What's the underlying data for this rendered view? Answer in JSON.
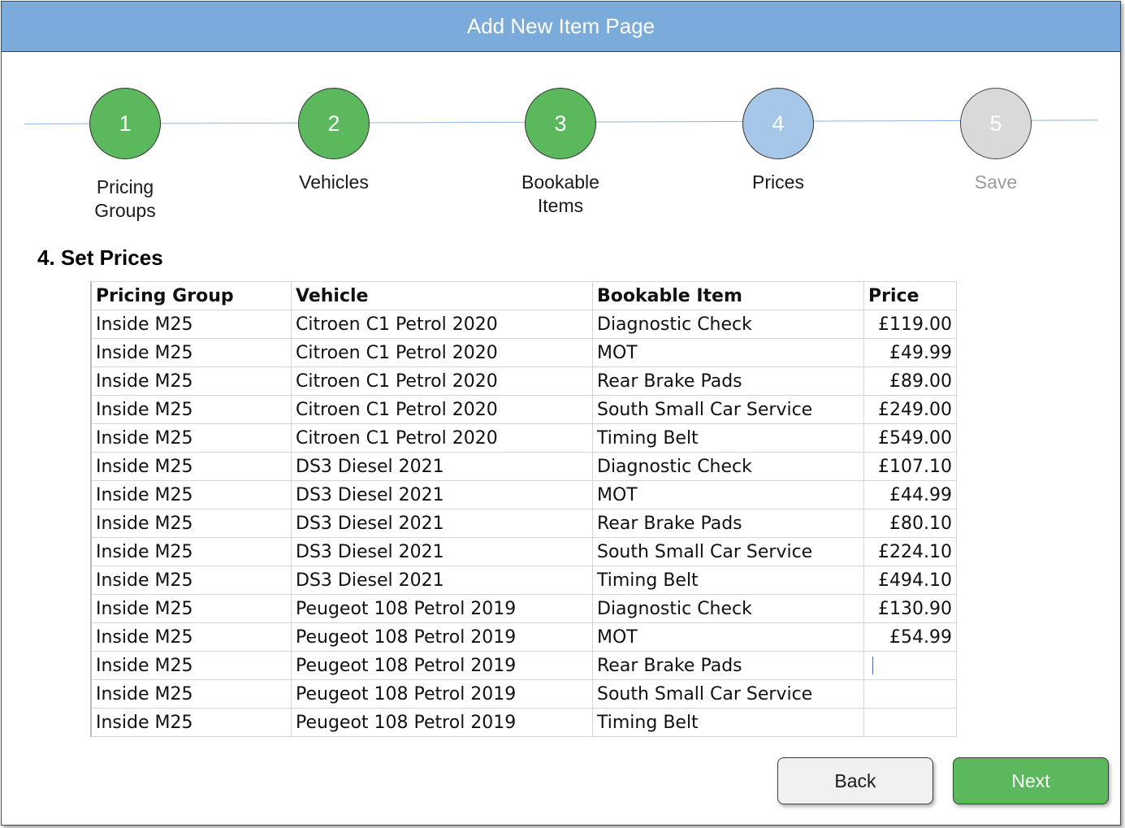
{
  "window": {
    "title": "Add New Item Page"
  },
  "steps": [
    {
      "number": "1",
      "label": "Pricing Groups",
      "state": "done"
    },
    {
      "number": "2",
      "label": "Vehicles",
      "state": "done"
    },
    {
      "number": "3",
      "label": "Bookable Items",
      "state": "done"
    },
    {
      "number": "4",
      "label": "Prices",
      "state": "active"
    },
    {
      "number": "5",
      "label": "Save",
      "state": "pending"
    }
  ],
  "section": {
    "title": "4. Set Prices"
  },
  "table": {
    "headers": [
      "Pricing Group",
      "Vehicle",
      "Bookable Item",
      "Price"
    ],
    "rows": [
      [
        "Inside M25",
        "Citroen C1 Petrol 2020",
        "Diagnostic Check",
        "£119.00"
      ],
      [
        "Inside M25",
        "Citroen C1 Petrol 2020",
        "MOT",
        "£49.99"
      ],
      [
        "Inside M25",
        "Citroen C1 Petrol 2020",
        "Rear Brake Pads",
        "£89.00"
      ],
      [
        "Inside M25",
        "Citroen C1 Petrol 2020",
        "South Small Car Service",
        "£249.00"
      ],
      [
        "Inside M25",
        "Citroen C1 Petrol 2020",
        "Timing Belt",
        "£549.00"
      ],
      [
        "Inside M25",
        "DS3 Diesel 2021",
        "Diagnostic Check",
        "£107.10"
      ],
      [
        "Inside M25",
        "DS3 Diesel 2021",
        "MOT",
        "£44.99"
      ],
      [
        "Inside M25",
        "DS3 Diesel 2021",
        "Rear Brake Pads",
        "£80.10"
      ],
      [
        "Inside M25",
        "DS3 Diesel 2021",
        "South Small Car Service",
        "£224.10"
      ],
      [
        "Inside M25",
        "DS3 Diesel 2021",
        "Timing Belt",
        "£494.10"
      ],
      [
        "Inside M25",
        "Peugeot 108 Petrol 2019",
        "Diagnostic Check",
        "£130.90"
      ],
      [
        "Inside M25",
        "Peugeot 108 Petrol 2019",
        "MOT",
        "£54.99"
      ],
      [
        "Inside M25",
        "Peugeot 108 Petrol 2019",
        "Rear Brake Pads",
        ""
      ],
      [
        "Inside M25",
        "Peugeot 108 Petrol 2019",
        "South Small Car Service",
        ""
      ],
      [
        "Inside M25",
        "Peugeot 108 Petrol 2019",
        "Timing Belt",
        ""
      ]
    ]
  },
  "buttons": {
    "back_label": "Back",
    "next_label": "Next"
  },
  "colors": {
    "header": "#7aabdb",
    "done": "#5cb85c",
    "active": "#a7c7e8",
    "pending": "#d9d9d9"
  }
}
